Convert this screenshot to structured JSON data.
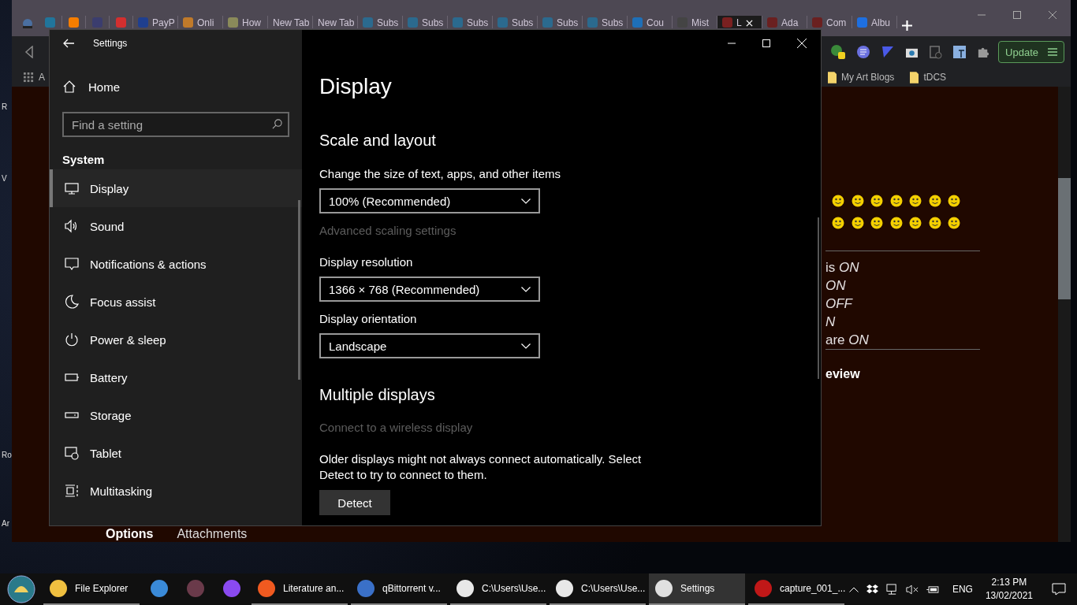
{
  "desktop_labels": [
    "R",
    "V",
    "Ro",
    "Ar"
  ],
  "browser": {
    "tabs": [
      {
        "selected": false,
        "color": "#21759b"
      },
      {
        "selected": false,
        "color": "#f57d00"
      },
      {
        "selected": false,
        "color": "#3b3d6e"
      },
      {
        "selected": false,
        "color": "#d32f2f"
      },
      {
        "label": "PayP",
        "selected": false,
        "color": "#1f3f8f"
      },
      {
        "label": "Onli",
        "selected": false,
        "color": "#c07a2a"
      },
      {
        "label": "How",
        "selected": false,
        "color": "#8a8a5a"
      },
      {
        "label": "New Tab",
        "selected": false
      },
      {
        "label": "New Tab",
        "selected": false
      },
      {
        "label": "Subs",
        "selected": false,
        "color": "#2b6a8e"
      },
      {
        "label": "Subs",
        "selected": false,
        "color": "#2b6a8e"
      },
      {
        "label": "Subs",
        "selected": false,
        "color": "#2b6a8e"
      },
      {
        "label": "Subs",
        "selected": false,
        "color": "#2b6a8e"
      },
      {
        "label": "Subs",
        "selected": false,
        "color": "#2b6a8e"
      },
      {
        "label": "Subs",
        "selected": false,
        "color": "#2b6a8e"
      },
      {
        "label": "Cou",
        "selected": false,
        "color": "#1e6fb7"
      },
      {
        "label": "Mist",
        "selected": false,
        "color": "#444444"
      },
      {
        "label": "L",
        "selected": true,
        "color": "#7a2020"
      },
      {
        "label": "Ada",
        "selected": false,
        "color": "#6a2020"
      },
      {
        "label": "Com",
        "selected": false,
        "color": "#6a2020"
      },
      {
        "label": "Albu",
        "selected": false,
        "color": "#1e6fe0"
      }
    ],
    "update_button": "Update",
    "bookmarks": [
      {
        "label": "A",
        "kind": "apps"
      },
      {
        "label": "My Art Blogs",
        "kind": "folder"
      },
      {
        "label": "tDCS",
        "kind": "folder"
      }
    ],
    "page": {
      "status_lines": [
        "is *ON*",
        "*ON*",
        "*OFF*",
        "*N*",
        "are *ON*"
      ],
      "heading": "eview",
      "bottom_links": [
        {
          "label": "Options",
          "selected": true
        },
        {
          "label": "Attachments",
          "selected": false
        }
      ]
    }
  },
  "settings": {
    "title": "Settings",
    "home": "Home",
    "search": {
      "placeholder": "Find a setting"
    },
    "section": "System",
    "nav": [
      {
        "label": "Display",
        "kind": "display",
        "selected": true
      },
      {
        "label": "Sound",
        "kind": "sound",
        "selected": false
      },
      {
        "label": "Notifications & actions",
        "kind": "notifications",
        "selected": false
      },
      {
        "label": "Focus assist",
        "kind": "focus",
        "selected": false
      },
      {
        "label": "Power & sleep",
        "kind": "power",
        "selected": false
      },
      {
        "label": "Battery",
        "kind": "battery",
        "selected": false
      },
      {
        "label": "Storage",
        "kind": "storage",
        "selected": false
      },
      {
        "label": "Tablet",
        "kind": "tablet",
        "selected": false
      },
      {
        "label": "Multitasking",
        "kind": "multitasking",
        "selected": false
      }
    ],
    "page_title": "Display",
    "groups": [
      {
        "heading": "Scale and layout",
        "items": [
          {
            "kind": "dropdown",
            "label": "Change the size of text, apps, and other items",
            "value": "100% (Recommended)"
          },
          {
            "kind": "link",
            "label": "Advanced scaling settings",
            "disabled": true
          },
          {
            "kind": "dropdown",
            "label": "Display resolution",
            "value": "1366 × 768 (Recommended)"
          },
          {
            "kind": "dropdown",
            "label": "Display orientation",
            "value": "Landscape"
          }
        ]
      },
      {
        "heading": "Multiple displays",
        "items": [
          {
            "kind": "link",
            "label": "Connect to a wireless display",
            "disabled": true
          },
          {
            "kind": "text",
            "label": "Older displays might not always connect automatically. Select Detect to try to connect to them."
          },
          {
            "kind": "button",
            "label": "Detect"
          }
        ]
      }
    ]
  },
  "taskbar": {
    "items": [
      {
        "label": "File Explorer",
        "color": "#f0c040",
        "running": true,
        "selected": false
      },
      {
        "color": "#3a8ad8",
        "running": false,
        "selected": false
      },
      {
        "color": "#6a3a4a",
        "running": false,
        "selected": false
      },
      {
        "color": "#8a4af0",
        "running": false,
        "selected": false
      },
      {
        "label": "Literature an...",
        "color": "#f05a20",
        "running": true,
        "selected": false
      },
      {
        "label": "qBittorrent v...",
        "color": "#3a70c8",
        "running": true,
        "selected": false
      },
      {
        "label": "C:\\Users\\Use...",
        "color": "#e8e8e8",
        "running": true,
        "selected": false
      },
      {
        "label": "C:\\Users\\Use...",
        "color": "#e8e8e8",
        "running": true,
        "selected": false
      },
      {
        "label": "Settings",
        "color": "#e0e0e0",
        "running": true,
        "selected": true
      },
      {
        "label": "capture_001_...",
        "color": "#c01818",
        "running": true,
        "selected": false
      }
    ],
    "language": "ENG",
    "time": "2:13 PM",
    "date": "13/02/2021"
  }
}
